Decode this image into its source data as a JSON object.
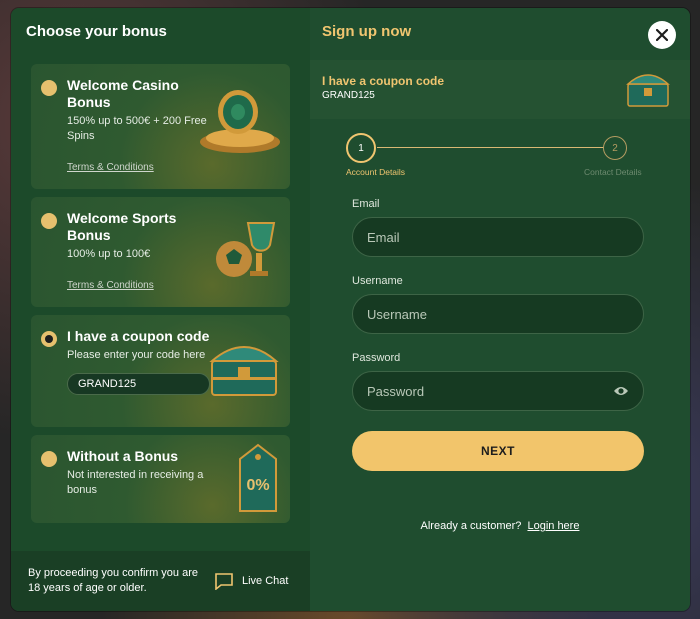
{
  "left": {
    "title": "Choose your bonus",
    "bonuses": [
      {
        "title": "Welcome Casino Bonus",
        "desc": "150% up to 500€ + 200 Free Spins",
        "terms": "Terms & Conditions"
      },
      {
        "title": "Welcome Sports Bonus",
        "desc": "100% up to 100€",
        "terms": "Terms & Conditions"
      },
      {
        "title": "I have a coupon code",
        "desc": "Please enter your code here",
        "coupon_value": "GRAND125"
      },
      {
        "title": "Without a Bonus",
        "desc": "Not interested in receiving a bonus",
        "art_text": "0%"
      }
    ],
    "footer": {
      "legal": "By proceeding you confirm you are 18 years of age or older.",
      "live_chat": "Live Chat"
    }
  },
  "right": {
    "title": "Sign up now",
    "coupon_banner": {
      "title": "I have a coupon code",
      "code": "GRAND125"
    },
    "steps": [
      {
        "num": "1",
        "label": "Account Details"
      },
      {
        "num": "2",
        "label": "Contact Details"
      }
    ],
    "form": {
      "email_label": "Email",
      "email_placeholder": "Email",
      "username_label": "Username",
      "username_placeholder": "Username",
      "password_label": "Password",
      "password_placeholder": "Password",
      "next_label": "NEXT"
    },
    "login": {
      "prompt": "Already a customer?",
      "link": "Login here"
    }
  },
  "colors": {
    "accent": "#f2c56b",
    "panel": "#1f4d2f",
    "card": "#2f5a30"
  }
}
